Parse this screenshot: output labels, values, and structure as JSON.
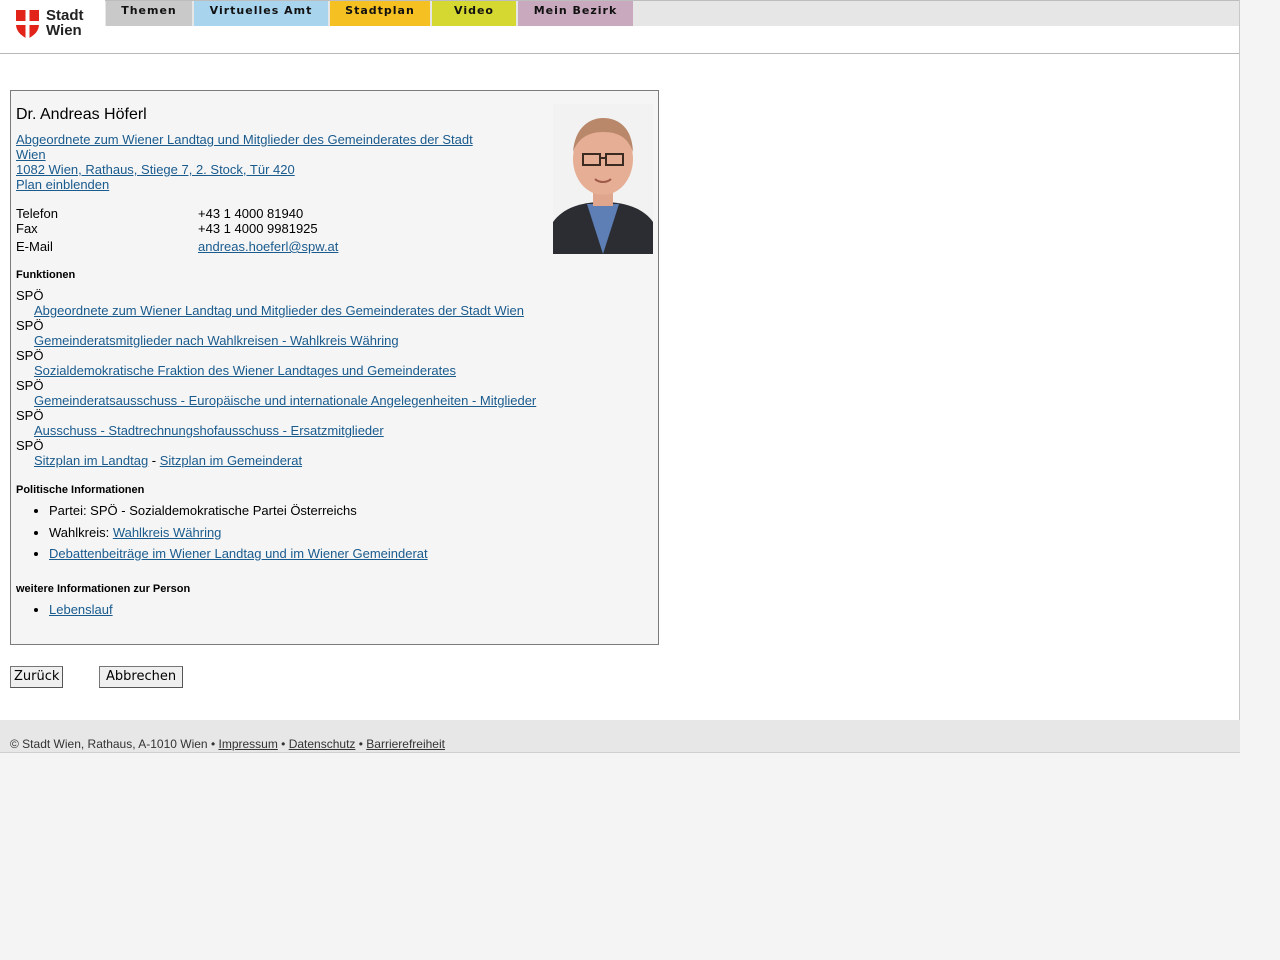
{
  "header": {
    "logo_line1": "Stadt",
    "logo_line2": "Wien",
    "tabs": [
      {
        "label": "Themen",
        "color": "#c9c9c9"
      },
      {
        "label": "Virtuelles Amt",
        "color": "#a8d4ee"
      },
      {
        "label": "Stadtplan",
        "color": "#f5c022"
      },
      {
        "label": "Video",
        "color": "#d6d832"
      },
      {
        "label": "Mein Bezirk",
        "color": "#c9a9be"
      }
    ]
  },
  "person": {
    "name": "Dr. Andreas Höferl",
    "role_link": "Abgeordnete zum Wiener Landtag und Mitglieder des Gemeinderates der Stadt Wien",
    "address_link": "1082 Wien, Rathaus, Stiege 7, 2. Stock, Tür 420",
    "plan_link": "Plan einblenden",
    "contact": [
      {
        "label": "Telefon",
        "value": "+43 1 4000 81940"
      },
      {
        "label": "Fax",
        "value": "+43 1 4000 9981925"
      },
      {
        "label": "E-Mail",
        "value": "andreas.hoeferl@spw.at"
      }
    ]
  },
  "functions": {
    "heading": "Funktionen",
    "items": [
      {
        "org": "SPÖ",
        "link": "Abgeordnete zum Wiener Landtag und Mitglieder des Gemeinderates der Stadt Wien"
      },
      {
        "org": "SPÖ",
        "link": "Gemeinderatsmitglieder nach Wahlkreisen - Wahlkreis Währing"
      },
      {
        "org": "SPÖ",
        "link": "Sozialdemokratische Fraktion des Wiener Landtages und Gemeinderates"
      },
      {
        "org": "SPÖ",
        "link": "Gemeinderatsausschuss - Europäische und internationale Angelegenheiten - Mitglieder"
      },
      {
        "org": "SPÖ",
        "link": "Ausschuss - Stadtrechnungshofausschuss - Ersatzmitglieder"
      }
    ],
    "last_org": "SPÖ",
    "seat_landtag": "Sitzplan im Landtag",
    "seat_separator": " - ",
    "seat_gemeinderat": "Sitzplan im Gemeinderat"
  },
  "political": {
    "heading": "Politische Informationen",
    "party": "Partei: SPÖ - Sozialdemokratische Partei Österreichs",
    "wahlkreis_label": "Wahlkreis: ",
    "wahlkreis_link": "Wahlkreis Währing",
    "debate_link": "Debattenbeiträge im Wiener Landtag und im Wiener Gemeinderat"
  },
  "more": {
    "heading": "weitere Informationen zur Person",
    "cv_link": "Lebenslauf"
  },
  "buttons": {
    "back": "Zurück",
    "cancel": "Abbrechen"
  },
  "footer": {
    "copyright": "© Stadt Wien, Rathaus, A-1010 Wien • ",
    "impressum": "Impressum",
    "sep1": " • ",
    "datenschutz": "Datenschutz",
    "sep2": " • ",
    "barrierefreiheit": "Barrierefreiheit"
  },
  "colors": {
    "link": "#1a5b8e",
    "logo_red": "#e2231a"
  }
}
